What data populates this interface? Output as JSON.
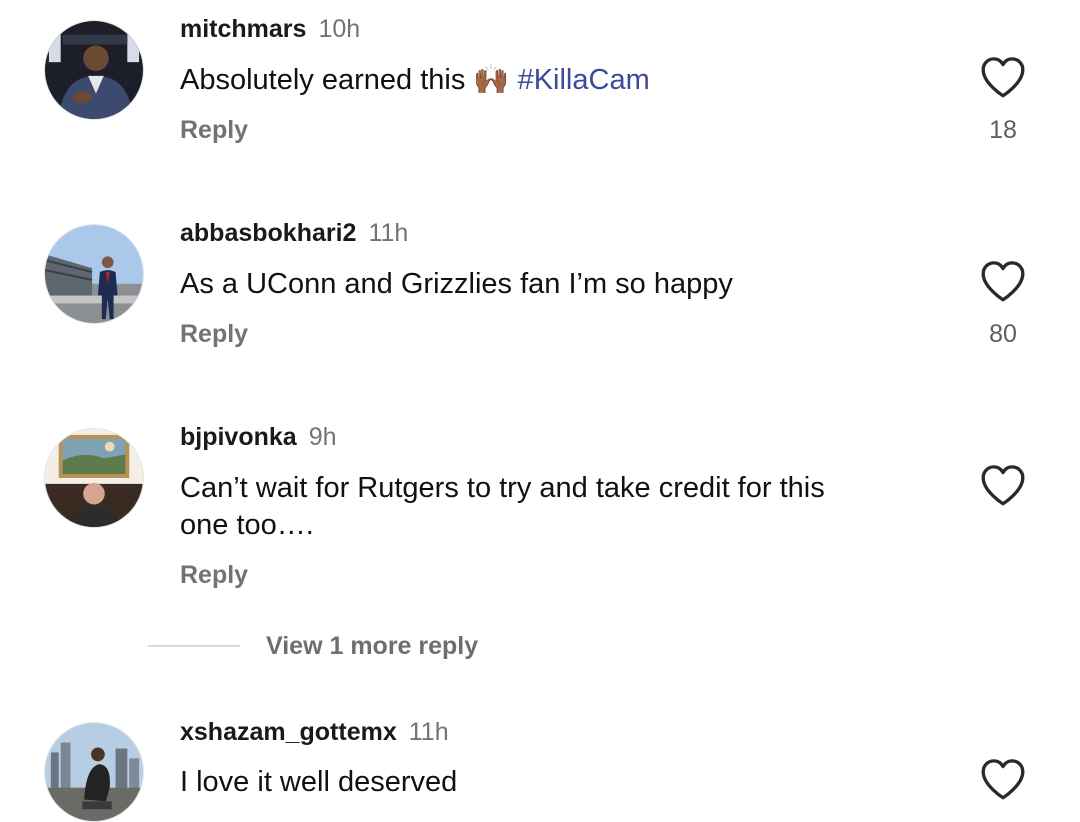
{
  "comments": [
    {
      "username": "mitchmars",
      "time": "10h",
      "text": "Absolutely earned this 🙌🏾",
      "hashtag": "#KillaCam",
      "reply": "Reply",
      "likes": "18",
      "avatar_icon": "avatar-man-in-suit-icon"
    },
    {
      "username": "abbasbokhari2",
      "time": "11h",
      "text": "As a UConn and Grizzlies fan I’m so happy",
      "reply": "Reply",
      "likes": "80",
      "avatar_icon": "avatar-man-at-stadium-icon"
    },
    {
      "username": "bjpivonka",
      "time": "9h",
      "text_line1": "Can’t wait for Rutgers to try and take credit for this",
      "text_line2": "one too….",
      "reply": "Reply",
      "avatar_icon": "avatar-man-with-painting-icon"
    },
    {
      "username": "xshazam_gottemx",
      "time": "11h",
      "text": "I love it well deserved",
      "avatar_icon": "avatar-man-crouching-city-icon"
    }
  ],
  "view_more": "View 1 more reply",
  "colors": {
    "hashtag": "#3d4a9a",
    "muted": "#737373",
    "heart_stroke": "#2a2a2a"
  }
}
